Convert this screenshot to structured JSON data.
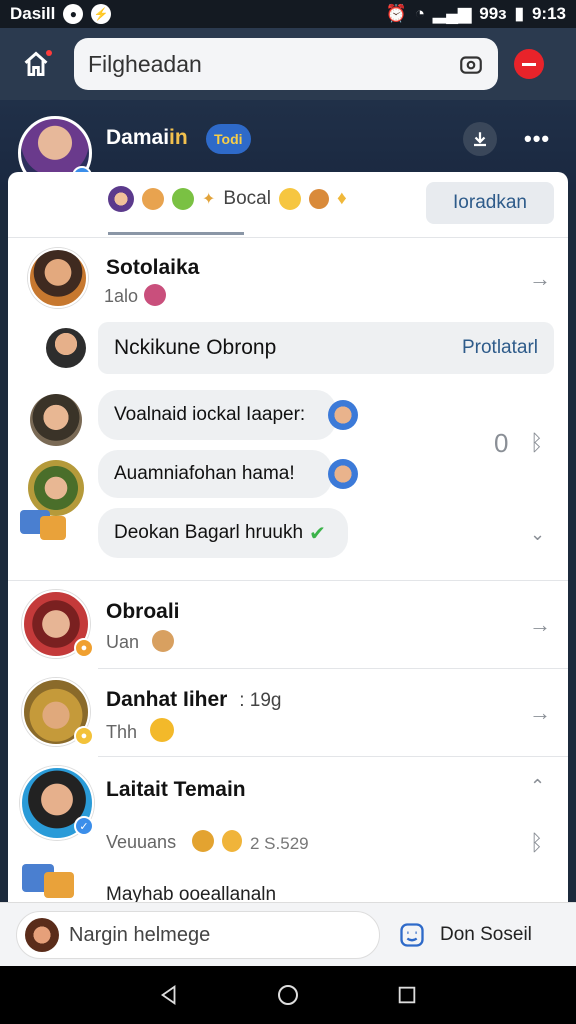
{
  "status": {
    "carrier": "Dasill",
    "battery": "99з",
    "time": "9:13"
  },
  "topbar": {
    "search_value": "Filgheadan"
  },
  "hero": {
    "name_main": "Damai",
    "name_accent": "in",
    "badge": "Todi"
  },
  "tabs": {
    "strip_label": "Bocal",
    "button_label": "Ioradkan"
  },
  "chat": {
    "thread_name": "Sotolaika",
    "thread_sub": "1alo",
    "card_text": "Nckikune Obronp",
    "card_action": "Protlatarl",
    "messages": [
      "Voalnaid iockal Iaaper:",
      "Auamniafohan hama!",
      "Deokan Bagarl hruukh"
    ],
    "side_count": "0"
  },
  "contacts": [
    {
      "name": "Obroali",
      "sub": "Uan"
    },
    {
      "name": "Danhat Iiher",
      "meta": "19g",
      "sub": "Thh"
    },
    {
      "name": "Laitait Temain",
      "sub": "Veuuans",
      "meta": "2 S.529"
    }
  ],
  "partial_row": "Mayhab ooeallanaln",
  "bottom": {
    "compose_placeholder": "Nargin helmege",
    "send_label": "Don Soseil"
  },
  "colors": {
    "accent": "#2e5b8a",
    "stop": "#e8232a",
    "verify": "#3b8eea",
    "header": "#2b3a4f"
  }
}
